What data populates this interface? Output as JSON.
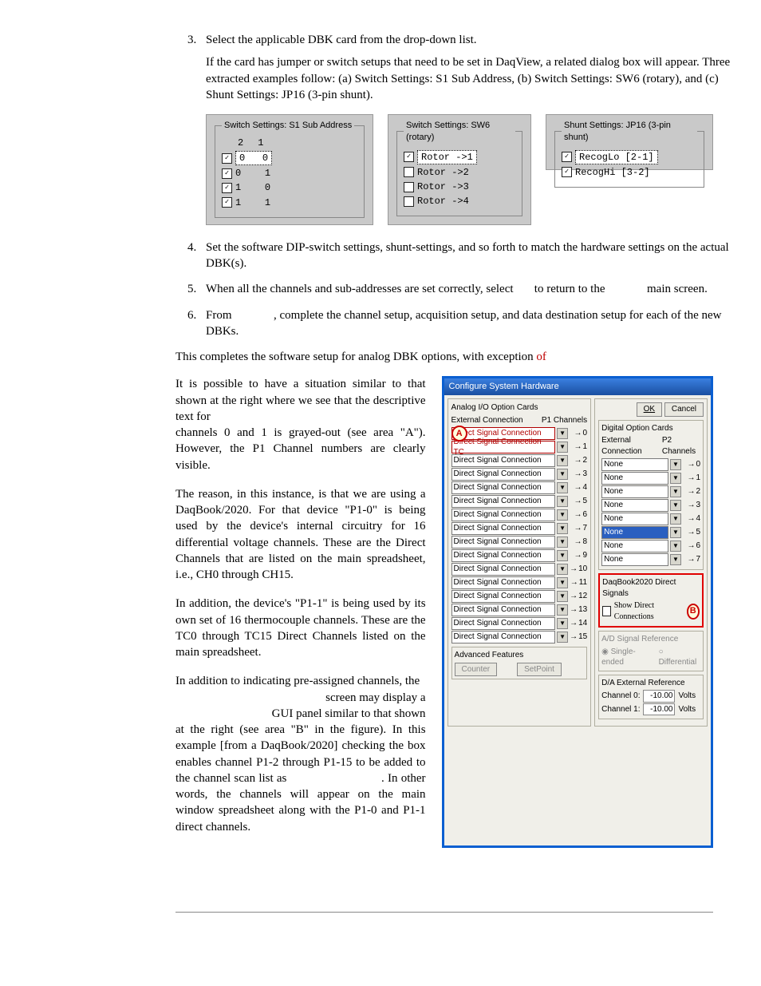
{
  "steps": {
    "s3": "Select the applicable DBK card from the drop-down list.",
    "s3b": "If the card has jumper or switch setups that need to be set in DaqView, a related dialog box will appear.  Three extracted examples follow:  (a) Switch Settings: S1 Sub Address, (b) Switch Settings: SW6 (rotary), and (c) Shunt Settings:  JP16 (3-pin shunt).",
    "s4": "Set the software DIP-switch settings, shunt-settings, and so forth to match the hardware settings on the actual DBK(s).",
    "s5a": "When all the channels and sub-addresses are set correctly, select ",
    "s5b": " to return to the ",
    "s5c": " main screen.",
    "s6a": "From ",
    "s6b": ", complete the channel setup, acquisition setup, and data destination setup for each of the new DBKs."
  },
  "panel1": {
    "legend": "Switch Settings: S1 Sub Address",
    "hdr1": "2",
    "hdr2": "1",
    "rows": [
      {
        "checked": true,
        "a": "0",
        "b": "0",
        "dotted": true
      },
      {
        "checked": true,
        "a": "0",
        "b": "1"
      },
      {
        "checked": true,
        "a": "1",
        "b": "0"
      },
      {
        "checked": true,
        "a": "1",
        "b": "1"
      }
    ]
  },
  "panel2": {
    "legend": "Switch Settings: SW6 (rotary)",
    "rows": [
      {
        "checked": true,
        "label": "Rotor ->1",
        "dotted": true
      },
      {
        "checked": false,
        "label": "Rotor ->2"
      },
      {
        "checked": false,
        "label": "Rotor ->3"
      },
      {
        "checked": false,
        "label": "Rotor ->4"
      }
    ]
  },
  "panel3": {
    "legend": "Shunt Settings: JP16 (3-pin shunt)",
    "rows": [
      {
        "checked": true,
        "label": "RecogLo [2-1]",
        "dotted": true
      },
      {
        "checked": true,
        "label": "RecogHi [3-2]"
      }
    ]
  },
  "closing": {
    "text": "This completes the software setup for analog DBK options, with exception ",
    "of": "of"
  },
  "prose": {
    "p1": "It is possible to have a situation similar to that shown at the right where we see that the descriptive text for",
    "p1b": "channels 0 and 1 is grayed-out (see area \"A\"). However, the P1 Channel numbers are clearly visible.",
    "p2": "The reason, in this instance, is that we are using a DaqBook/2020.  For that device \"P1-0\" is being used by the device's internal circuitry for 16 differential voltage channels.  These are the Direct Channels that are listed on the main spreadsheet, i.e., CH0 through CH15.",
    "p3": "In addition, the device's \"P1-1\" is being used by its own set of 16 thermocouple channels.  These are the TC0 through TC15 Direct Channels listed on the main spreadsheet.",
    "p4a": "In addition to indicating pre-assigned channels, the",
    "p4b": "screen may display a",
    "p4c": "GUI panel similar to that shown",
    "p4d": "at the right (see area \"B\" in the figure).  In this example [from a DaqBook/2020] checking the box enables channel P1-2 through P1-15 to be added to the channel scan list as ",
    "p4e": ".  In other words, the channels will appear on the main window spreadsheet along with the P1-0 and P1-1 direct channels."
  },
  "dialog": {
    "title": "Configure System Hardware",
    "analog_group": "Analog I/O Option Cards",
    "ext_conn": "External Connection",
    "p1": "P1 Channels",
    "digital_group": "Digital Option Cards",
    "p2": "P2 Channels",
    "ok": "OK",
    "cancel": "Cancel",
    "rows_left": [
      {
        "text": "Direct Signal Connection",
        "red": true,
        "n": "0"
      },
      {
        "text": "Direct Signal Connection TC",
        "red": true,
        "n": "1"
      },
      {
        "text": "Direct Signal Connection",
        "n": "2"
      },
      {
        "text": "Direct Signal Connection",
        "n": "3"
      },
      {
        "text": "Direct Signal Connection",
        "n": "4"
      },
      {
        "text": "Direct Signal Connection",
        "n": "5"
      },
      {
        "text": "Direct Signal Connection",
        "n": "6"
      },
      {
        "text": "Direct Signal Connection",
        "n": "7"
      },
      {
        "text": "Direct Signal Connection",
        "n": "8"
      },
      {
        "text": "Direct Signal Connection",
        "n": "9"
      },
      {
        "text": "Direct Signal Connection",
        "n": "10"
      },
      {
        "text": "Direct Signal Connection",
        "n": "11"
      },
      {
        "text": "Direct Signal Connection",
        "n": "12"
      },
      {
        "text": "Direct Signal Connection",
        "n": "13"
      },
      {
        "text": "Direct Signal Connection",
        "n": "14"
      },
      {
        "text": "Direct Signal Connection",
        "n": "15"
      }
    ],
    "rows_right": [
      {
        "text": "None",
        "n": "0"
      },
      {
        "text": "None",
        "n": "1"
      },
      {
        "text": "None",
        "n": "2"
      },
      {
        "text": "None",
        "n": "3"
      },
      {
        "text": "None",
        "n": "4"
      },
      {
        "text": "None",
        "n": "5",
        "hl": true
      },
      {
        "text": "None",
        "n": "6"
      },
      {
        "text": "None",
        "n": "7"
      }
    ],
    "direct_group": "DaqBook2020 Direct Signals",
    "direct_cb": "Show Direct Connections",
    "ad_group": "A/D Signal Reference",
    "ad_se": "Single-ended",
    "ad_diff": "Differential",
    "da_group": "D/A External Reference",
    "ch0": "Channel 0:",
    "ch1": "Channel 1:",
    "volts": "Volts",
    "val": "-10.00",
    "adv": "Advanced Features",
    "counter": "Counter",
    "setpoint": "SetPoint",
    "markerA": "A",
    "markerB": "B"
  }
}
